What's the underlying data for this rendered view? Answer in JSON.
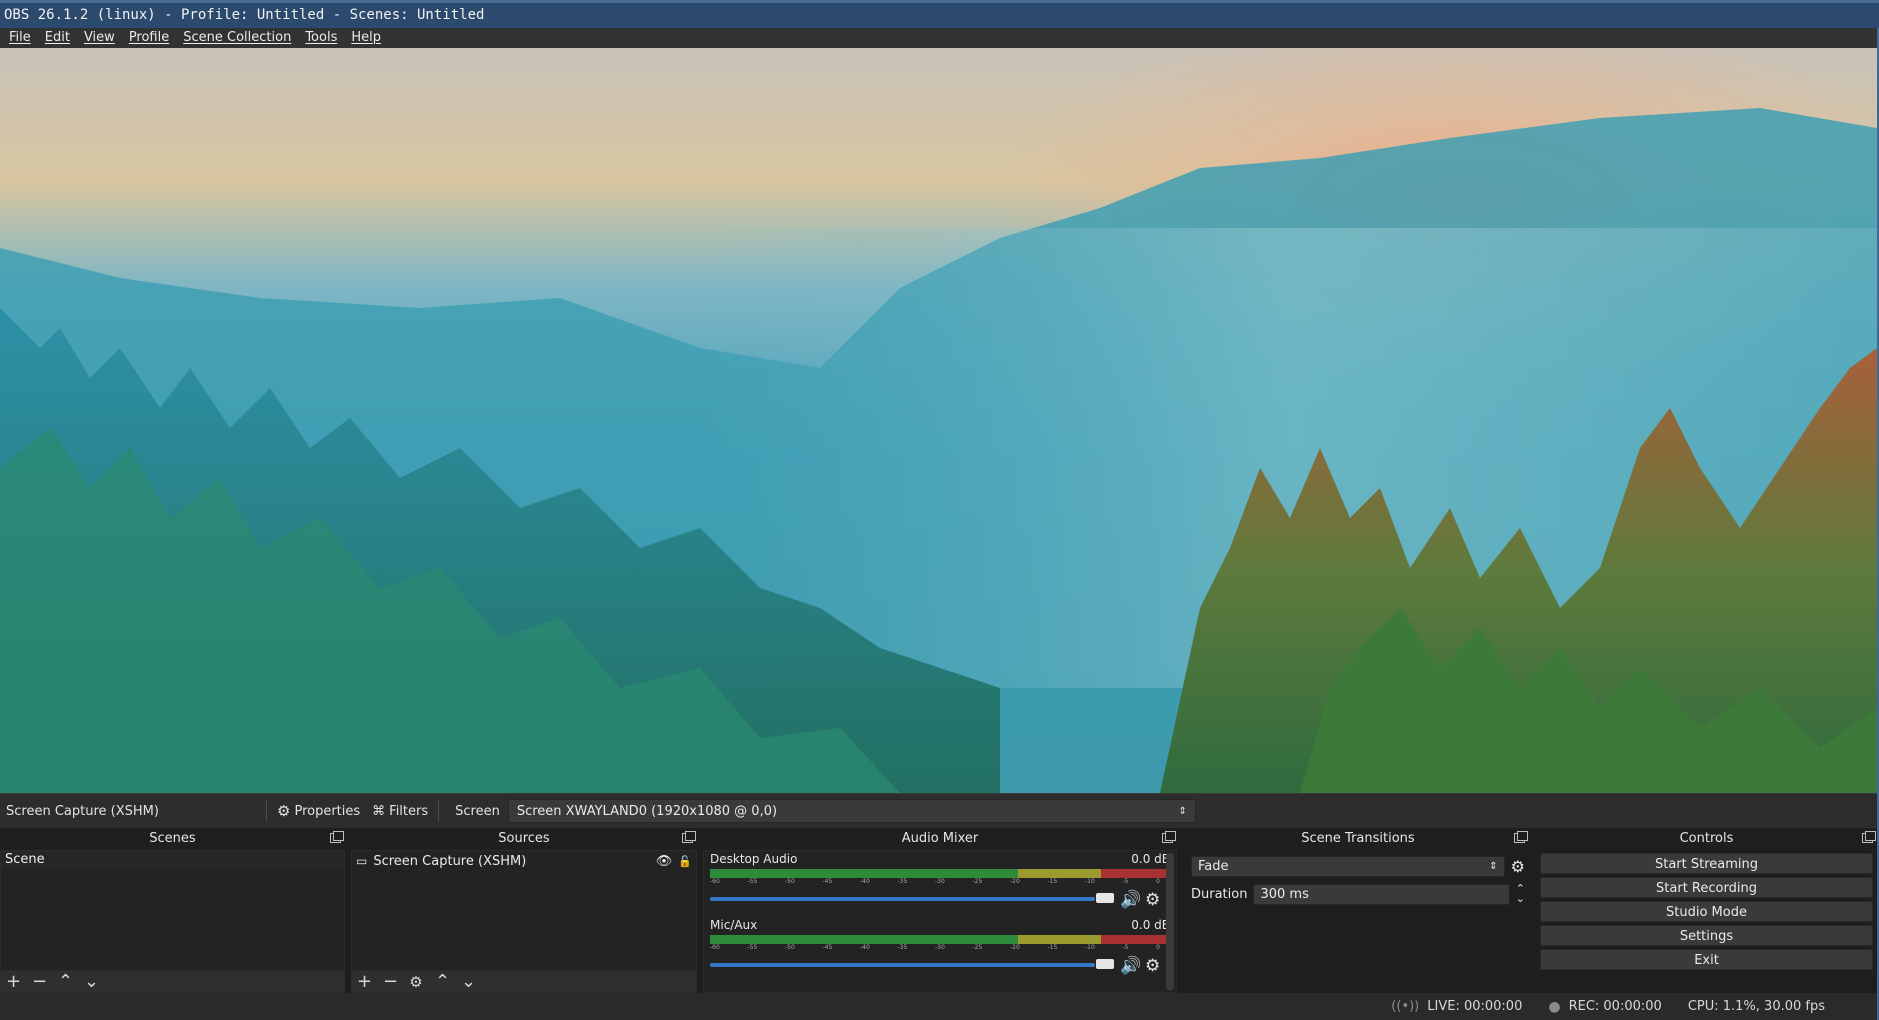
{
  "window": {
    "title": "OBS 26.1.2 (linux) - Profile: Untitled - Scenes: Untitled"
  },
  "menu": [
    "File",
    "Edit",
    "View",
    "Profile",
    "Scene Collection",
    "Tools",
    "Help"
  ],
  "context_bar": {
    "source_name": "Screen Capture (XSHM)",
    "properties_label": "Properties",
    "filters_label": "Filters",
    "screen_label": "Screen",
    "screen_value": "Screen XWAYLAND0 (1920x1080 @ 0,0)"
  },
  "docks": {
    "scenes": {
      "title": "Scenes",
      "items": [
        "Scene"
      ]
    },
    "sources": {
      "title": "Sources",
      "items": [
        {
          "name": "Screen Capture (XSHM)",
          "visible": true,
          "locked": false
        }
      ]
    },
    "audio_mixer": {
      "title": "Audio Mixer",
      "channels": [
        {
          "name": "Desktop Audio",
          "level": "0.0 dB",
          "volume_fraction": 1.0
        },
        {
          "name": "Mic/Aux",
          "level": "0.0 dB",
          "volume_fraction": 1.0
        }
      ],
      "meter_ticks": [
        "-60",
        "-55",
        "-50",
        "-45",
        "-40",
        "-35",
        "-30",
        "-25",
        "-20",
        "-15",
        "-10",
        "-5",
        "0"
      ]
    },
    "scene_transitions": {
      "title": "Scene Transitions",
      "transition": "Fade",
      "duration_label": "Duration",
      "duration_value": "300 ms"
    },
    "controls": {
      "title": "Controls",
      "buttons": [
        "Start Streaming",
        "Start Recording",
        "Studio Mode",
        "Settings",
        "Exit"
      ]
    }
  },
  "status": {
    "live": "LIVE: 00:00:00",
    "rec": "REC: 00:00:00",
    "cpu": "CPU: 1.1%, 30.00 fps"
  },
  "colors": {
    "titlebar": "#2b4a6e",
    "fader": "#3279c7",
    "meter_green": "#2e8b3a",
    "meter_yellow": "#9a9a2e",
    "meter_red": "#a83232"
  },
  "icons": {
    "properties": "gear-icon",
    "filters": "filter-icon",
    "visibility": "eye-icon",
    "lock": "lock-icon",
    "mute": "speaker-icon",
    "settings": "gear-icon"
  }
}
